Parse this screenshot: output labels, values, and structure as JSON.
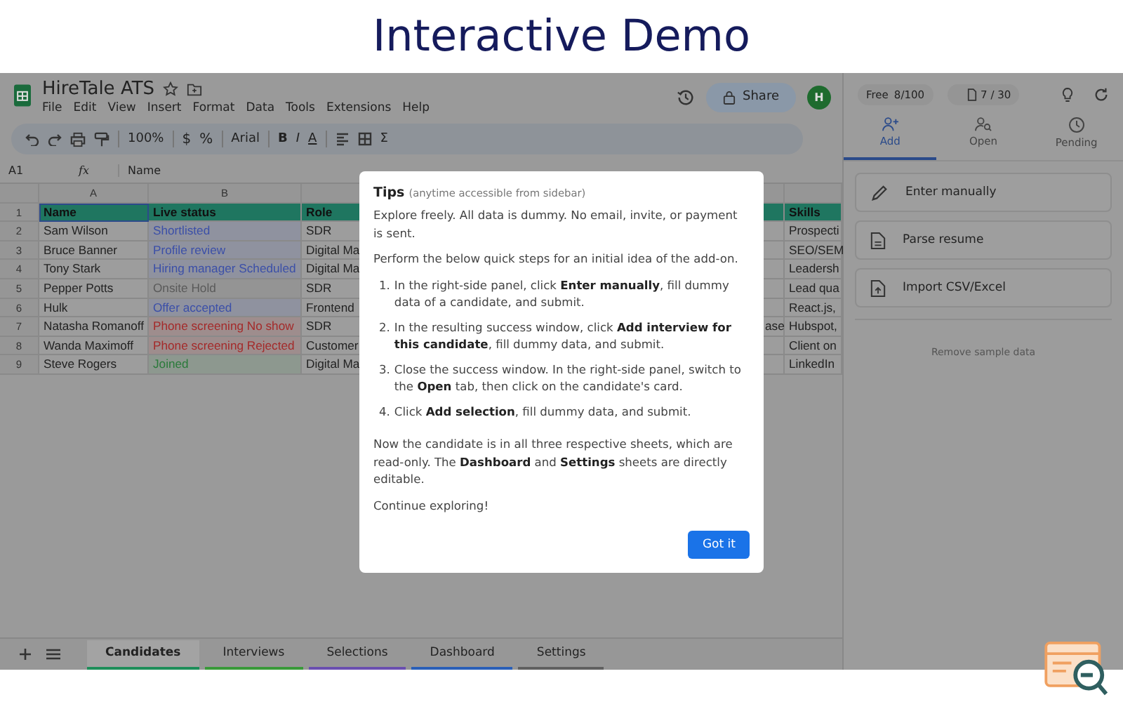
{
  "banner": {
    "title": "Interactive Demo"
  },
  "document": {
    "title": "HireTale ATS",
    "menu": [
      "File",
      "Edit",
      "View",
      "Insert",
      "Format",
      "Data",
      "Tools",
      "Extensions",
      "Help"
    ],
    "share_label": "Share",
    "avatar_letter": "H"
  },
  "toolbar": {
    "zoom": "100%",
    "currency": "$",
    "percent": "%",
    "font": "Arial",
    "bold": "B",
    "italic": "I",
    "text_color": "A",
    "sum": "Σ"
  },
  "formula_bar": {
    "cell": "A1",
    "fx": "fx",
    "value": "Name"
  },
  "column_letters": [
    "A",
    "B"
  ],
  "table": {
    "headers": [
      "Name",
      "Live status",
      "Role",
      "Skills"
    ],
    "rows": [
      {
        "number": "2",
        "name": "Sam Wilson",
        "status": "Shortlisted",
        "color": "#3b4fa8",
        "role": "SDR",
        "column_5": "",
        "skills": "Prospecti"
      },
      {
        "number": "3",
        "name": "Bruce Banner",
        "status": "Profile review",
        "color": "#3b4fa8",
        "role": "Digital Ma",
        "column_5": "",
        "skills": "SEO/SEM"
      },
      {
        "number": "4",
        "name": "Tony Stark",
        "status": "Hiring manager Scheduled",
        "color": "#3b4fa8",
        "role": "Digital Ma",
        "column_5": "",
        "skills": "Leadersh"
      },
      {
        "number": "5",
        "name": "Pepper Potts",
        "status": "Onsite Hold",
        "color": "#5a5a5a",
        "role": "SDR",
        "column_5": "",
        "skills": "Lead qua"
      },
      {
        "number": "6",
        "name": "Hulk",
        "status": "Offer accepted",
        "color": "#3b4fa8",
        "role": "Frontend",
        "column_5": "",
        "skills": "React.js,"
      },
      {
        "number": "7",
        "name": "Natasha Romanoff",
        "status": "Phone screening No show",
        "color": "#a42a2a",
        "role": "SDR",
        "column_5": "ase",
        "skills": "Hubspot,"
      },
      {
        "number": "8",
        "name": "Wanda Maximoff",
        "status": "Phone screening Rejected",
        "color": "#a42a2a",
        "role": "Customer",
        "column_5": "",
        "skills": "Client on"
      },
      {
        "number": "9",
        "name": "Steve Rogers",
        "status": "Joined",
        "color": "#2a7a3a",
        "role": "Digital Ma",
        "column_5": "",
        "skills": "LinkedIn"
      }
    ]
  },
  "header_row_number": "1",
  "sheet_tabs": [
    {
      "label": "Candidates",
      "selected": true,
      "color": "#1e8e5a"
    },
    {
      "label": "Interviews",
      "selected": false,
      "color": "#3a9a3a"
    },
    {
      "label": "Selections",
      "selected": false,
      "color": "#6a4fb0"
    },
    {
      "label": "Dashboard",
      "selected": false,
      "color": "#2a5fb8"
    },
    {
      "label": "Settings",
      "selected": false,
      "color": "#606060"
    }
  ],
  "panel": {
    "plan": "Free",
    "usage": "8/100",
    "docs": "7 / 30",
    "tabs": [
      {
        "label": "Add",
        "selected": true,
        "kind": "add"
      },
      {
        "label": "Open",
        "selected": false,
        "kind": "open"
      },
      {
        "label": "Pending",
        "selected": false,
        "kind": "pending"
      }
    ],
    "actions": [
      {
        "label": "Enter manually",
        "kind": "pencil"
      },
      {
        "label": "Parse resume",
        "kind": "document"
      },
      {
        "label": "Import CSV/Excel",
        "kind": "import"
      }
    ],
    "remove_link": "Remove sample data"
  },
  "dialog": {
    "title": "Tips",
    "subtitle": "(anytime accessible from sidebar)",
    "intro": [
      "Explore freely. All data is dummy. No email, invite, or payment is sent.",
      "Perform the below quick steps for an initial idea of the add-on."
    ],
    "steps": [
      {
        "number": "1.",
        "text": "In the right-side panel, click **Enter manually**, fill dummy data of a candidate, and submit."
      },
      {
        "number": "2.",
        "text": "In the resulting success window, click **Add interview for this candidate**, fill dummy data, and submit."
      },
      {
        "number": "3.",
        "text": "Close the success window. In the right-side panel, switch to the **Open** tab, then click on the candidate's card."
      },
      {
        "number": "4.",
        "text": "Click **Add selection**, fill dummy data, and submit."
      }
    ],
    "outro": [
      "Now the candidate is in all three respective sheets, which are read-only. The **Dashboard** and **Settings** sheets are directly editable.",
      "Continue exploring!"
    ],
    "button": "Got it"
  }
}
